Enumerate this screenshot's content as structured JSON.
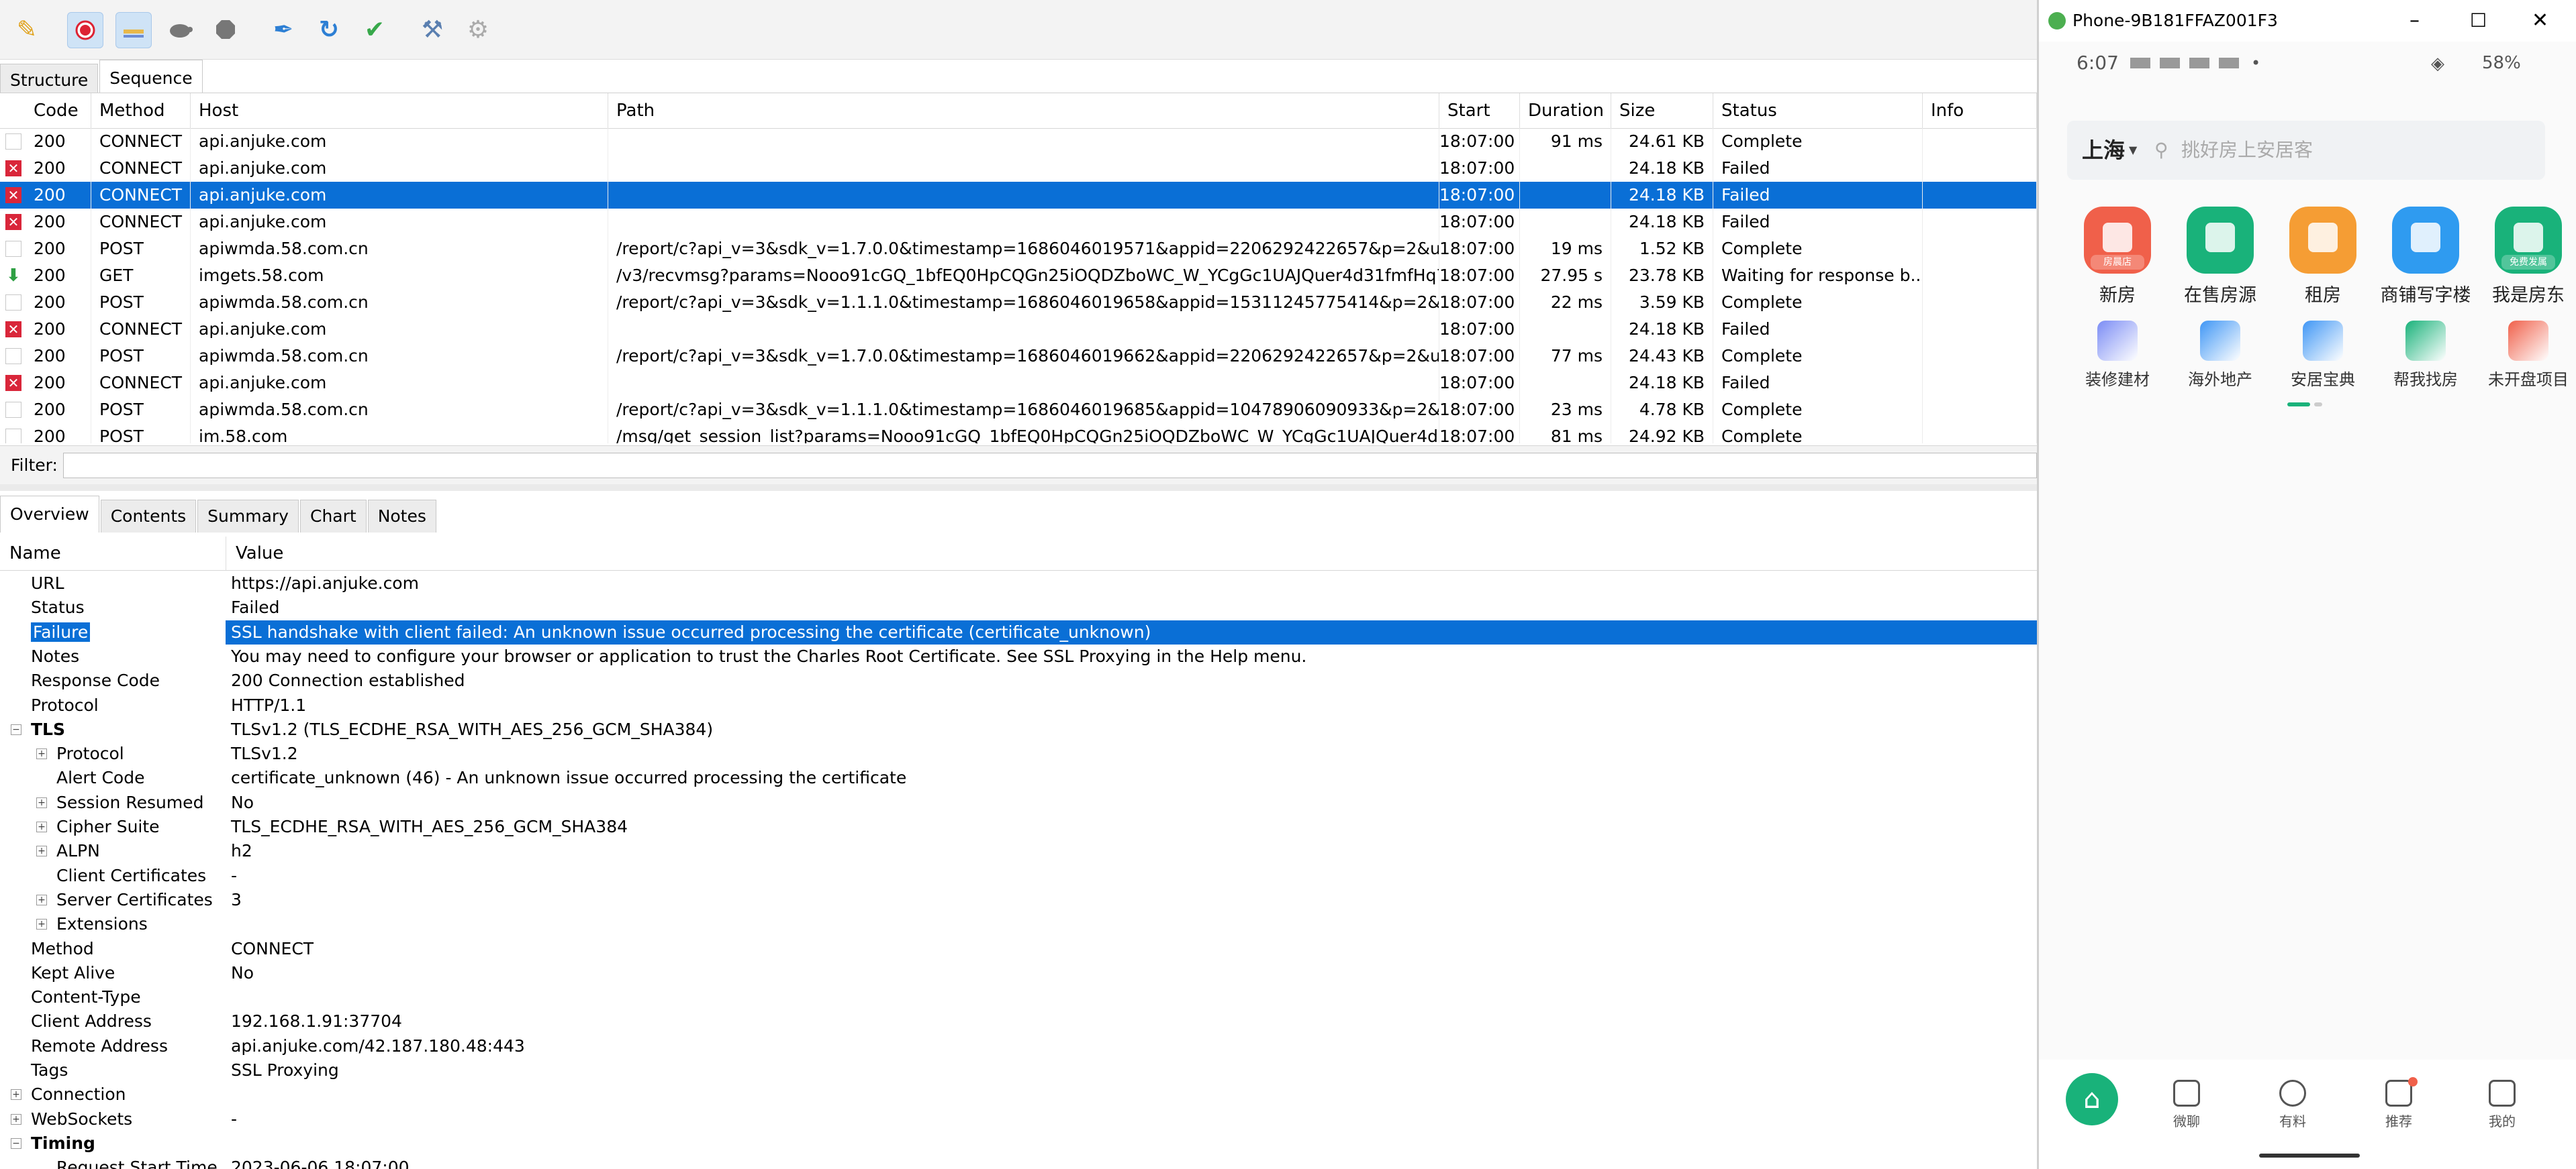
{
  "charles": {
    "tabs": [
      "Structure",
      "Sequence"
    ],
    "columns": [
      "Code",
      "Method",
      "Host",
      "Path",
      "Start",
      "Duration",
      "Size",
      "Status",
      "Info"
    ],
    "rows": [
      {
        "icon": "doc",
        "code": "200",
        "method": "CONNECT",
        "host": "api.anjuke.com",
        "path": "",
        "start": "18:07:00",
        "duration": "91 ms",
        "size": "24.61 KB",
        "status": "Complete",
        "info": ""
      },
      {
        "icon": "err",
        "code": "200",
        "method": "CONNECT",
        "host": "api.anjuke.com",
        "path": "",
        "start": "18:07:00",
        "duration": "",
        "size": "24.18 KB",
        "status": "Failed",
        "info": ""
      },
      {
        "icon": "err",
        "code": "200",
        "method": "CONNECT",
        "host": "api.anjuke.com",
        "path": "",
        "start": "18:07:00",
        "duration": "",
        "size": "24.18 KB",
        "status": "Failed",
        "info": "",
        "selected": true
      },
      {
        "icon": "err",
        "code": "200",
        "method": "CONNECT",
        "host": "api.anjuke.com",
        "path": "",
        "start": "18:07:00",
        "duration": "",
        "size": "24.18 KB",
        "status": "Failed",
        "info": ""
      },
      {
        "icon": "doc",
        "code": "200",
        "method": "POST",
        "host": "apiwmda.58.com.cn",
        "path": "/report/c?api_v=3&sdk_v=1.7.0.0&timestamp=1686046019571&appid=2206292422657&p=2&uuid=7...",
        "start": "18:07:00",
        "duration": "19 ms",
        "size": "1.52 KB",
        "status": "Complete",
        "info": ""
      },
      {
        "icon": "dl",
        "code": "200",
        "method": "GET",
        "host": "imgets.58.com",
        "path": "/v3/recvmsg?params=Nooo91cGQ_1bfEQ0HpCQGn25iOQDZboWC_W_YCgGc1UAJQuer4d31fmfHq7ie...",
        "start": "18:07:00",
        "duration": "27.95 s",
        "size": "23.78 KB",
        "status": "Waiting for response b...",
        "info": ""
      },
      {
        "icon": "doc",
        "code": "200",
        "method": "POST",
        "host": "apiwmda.58.com.cn",
        "path": "/report/c?api_v=3&sdk_v=1.1.1.0&timestamp=1686046019658&appid=15311245775414&p=2&uuid=...",
        "start": "18:07:00",
        "duration": "22 ms",
        "size": "3.59 KB",
        "status": "Complete",
        "info": ""
      },
      {
        "icon": "err",
        "code": "200",
        "method": "CONNECT",
        "host": "api.anjuke.com",
        "path": "",
        "start": "18:07:00",
        "duration": "",
        "size": "24.18 KB",
        "status": "Failed",
        "info": ""
      },
      {
        "icon": "doc",
        "code": "200",
        "method": "POST",
        "host": "apiwmda.58.com.cn",
        "path": "/report/c?api_v=3&sdk_v=1.7.0.0&timestamp=1686046019662&appid=2206292422657&p=2&uuid=7...",
        "start": "18:07:00",
        "duration": "77 ms",
        "size": "24.43 KB",
        "status": "Complete",
        "info": ""
      },
      {
        "icon": "err",
        "code": "200",
        "method": "CONNECT",
        "host": "api.anjuke.com",
        "path": "",
        "start": "18:07:00",
        "duration": "",
        "size": "24.18 KB",
        "status": "Failed",
        "info": ""
      },
      {
        "icon": "doc",
        "code": "200",
        "method": "POST",
        "host": "apiwmda.58.com.cn",
        "path": "/report/c?api_v=3&sdk_v=1.1.1.0&timestamp=1686046019685&appid=10478906090933&p=2&uuid=...",
        "start": "18:07:00",
        "duration": "23 ms",
        "size": "4.78 KB",
        "status": "Complete",
        "info": ""
      },
      {
        "icon": "doc",
        "code": "200",
        "method": "POST",
        "host": "im.58.com",
        "path": "/msg/get_session_list?params=Nooo91cGQ_1bfEQ0HpCQGn25iOQDZboWC_W_YCgGc1UAJQuer4d31f...",
        "start": "18:07:00",
        "duration": "81 ms",
        "size": "24.92 KB",
        "status": "Complete",
        "info": ""
      }
    ],
    "filter_label": "Filter:",
    "detail_tabs": [
      "Overview",
      "Contents",
      "Summary",
      "Chart",
      "Notes"
    ],
    "detail_headers": {
      "name": "Name",
      "value": "Value"
    },
    "overview": [
      {
        "name": "URL",
        "value": "https://api.anjuke.com",
        "indent": 1
      },
      {
        "name": "Status",
        "value": "Failed",
        "indent": 1
      },
      {
        "name": "Failure",
        "value": "SSL handshake with client failed: An unknown issue occurred processing the certificate (certificate_unknown)",
        "indent": 1,
        "selected": true
      },
      {
        "name": "Notes",
        "value": "You may need to configure your browser or application to trust the Charles Root Certificate. See SSL Proxying in the Help menu.",
        "indent": 1
      },
      {
        "name": "Response Code",
        "value": "200 Connection established",
        "indent": 1
      },
      {
        "name": "Protocol",
        "value": "HTTP/1.1",
        "indent": 1
      },
      {
        "name": "TLS",
        "value": "TLSv1.2 (TLS_ECDHE_RSA_WITH_AES_256_GCM_SHA384)",
        "indent": 1,
        "bold": true,
        "toggle": "minus"
      },
      {
        "name": "Protocol",
        "value": "TLSv1.2",
        "indent": 2,
        "toggle": "plus"
      },
      {
        "name": "Alert Code",
        "value": "certificate_unknown (46) - An unknown issue occurred processing the certificate",
        "indent": 2
      },
      {
        "name": "Session Resumed",
        "value": "No",
        "indent": 2,
        "toggle": "plus"
      },
      {
        "name": "Cipher Suite",
        "value": "TLS_ECDHE_RSA_WITH_AES_256_GCM_SHA384",
        "indent": 2,
        "toggle": "plus"
      },
      {
        "name": "ALPN",
        "value": "h2",
        "indent": 2,
        "toggle": "plus"
      },
      {
        "name": "Client Certificates",
        "value": "-",
        "indent": 2
      },
      {
        "name": "Server Certificates",
        "value": "3",
        "indent": 2,
        "toggle": "plus"
      },
      {
        "name": "Extensions",
        "value": "",
        "indent": 2,
        "toggle": "plus"
      },
      {
        "name": "Method",
        "value": "CONNECT",
        "indent": 1
      },
      {
        "name": "Kept Alive",
        "value": "No",
        "indent": 1
      },
      {
        "name": "Content-Type",
        "value": "",
        "indent": 1
      },
      {
        "name": "Client Address",
        "value": "192.168.1.91:37704",
        "indent": 1
      },
      {
        "name": "Remote Address",
        "value": "api.anjuke.com/42.187.180.48:443",
        "indent": 1
      },
      {
        "name": "Tags",
        "value": "SSL Proxying",
        "indent": 1
      },
      {
        "name": "Connection",
        "value": "",
        "indent": 1,
        "toggle": "plus"
      },
      {
        "name": "WebSockets",
        "value": "-",
        "indent": 1,
        "toggle": "plus"
      },
      {
        "name": "Timing",
        "value": "",
        "indent": 1,
        "bold": true,
        "toggle": "minus"
      },
      {
        "name": "Request Start Time",
        "value": "2023-06-06 18:07:00",
        "indent": 2
      }
    ]
  },
  "phone": {
    "window_title": "Phone-9B181FFAZ001F3",
    "time": "6:07",
    "status_icons": "•",
    "battery": "58%",
    "city": "上海",
    "search_placeholder": "挑好房上安居客",
    "apps": [
      {
        "label": "新房",
        "color": "#f0604a",
        "badge": "房晨店"
      },
      {
        "label": "在售房源",
        "color": "#19b27a",
        "badge": ""
      },
      {
        "label": "租房",
        "color": "#f59d34",
        "badge": ""
      },
      {
        "label": "商铺写字楼",
        "color": "#2f9bf0",
        "badge": ""
      },
      {
        "label": "我是房东",
        "color": "#19b27a",
        "badge": "免费发属"
      }
    ],
    "small_apps": [
      {
        "label": "装修建材",
        "color": "#7b8cf5"
      },
      {
        "label": "海外地产",
        "color": "#3f96f5"
      },
      {
        "label": "安居宝典",
        "color": "#3f96f5"
      },
      {
        "label": "帮我找房",
        "color": "#19b27a"
      },
      {
        "label": "未开盘项目",
        "color": "#f0604a"
      }
    ],
    "nav": [
      {
        "label": "",
        "icon": "home-icon"
      },
      {
        "label": "微聊",
        "icon": "chat-icon"
      },
      {
        "label": "有料",
        "icon": "discover-icon"
      },
      {
        "label": "推荐",
        "icon": "recommend-icon"
      },
      {
        "label": "我的",
        "icon": "profile-icon"
      }
    ]
  }
}
